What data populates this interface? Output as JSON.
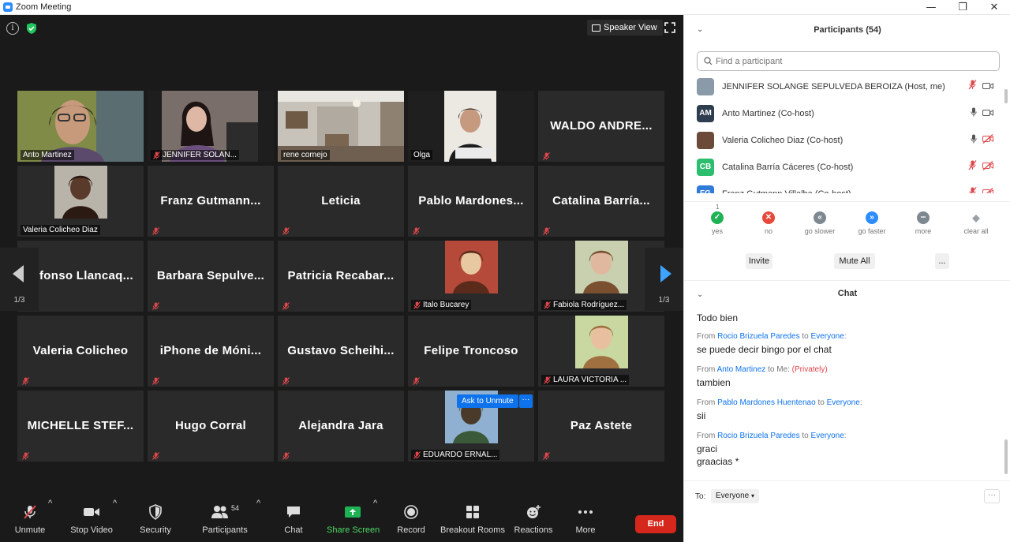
{
  "window": {
    "title": "Zoom Meeting",
    "controls": [
      "—",
      "❐",
      "✕"
    ]
  },
  "meeting": {
    "speaker_view": "Speaker View",
    "page_indicator": "1/3",
    "ask_unmute": "Ask to Unmute",
    "ask_more": "···",
    "tiles": [
      {
        "name": "Anto Martinez",
        "style": "video",
        "muted": false
      },
      {
        "name": "JENNIFER SOLAN...",
        "style": "video",
        "muted": true
      },
      {
        "name": "rene cornejo",
        "style": "video",
        "muted": false
      },
      {
        "name": "Olga",
        "style": "video",
        "muted": false
      },
      {
        "name": "WALDO  ANDRE...",
        "style": "name",
        "muted": true
      },
      {
        "name": "Valeria Colicheo Diaz",
        "style": "photo",
        "muted": false
      },
      {
        "name": "Franz  Gutmann...",
        "style": "name",
        "muted": true
      },
      {
        "name": "Leticia",
        "style": "name",
        "muted": true
      },
      {
        "name": "Pablo  Mardones...",
        "style": "name",
        "muted": true
      },
      {
        "name": "Catalina  Barría...",
        "style": "name",
        "muted": true
      },
      {
        "name": "fonso  Llancaq...",
        "style": "name",
        "muted": true
      },
      {
        "name": "Barbara  Sepulve...",
        "style": "name",
        "muted": true
      },
      {
        "name": "Patricia  Recabar...",
        "style": "name",
        "muted": true
      },
      {
        "name": "Italo Bucarey",
        "style": "photo",
        "muted": true
      },
      {
        "name": "Fabiola Rodríguez...",
        "style": "photo",
        "muted": true
      },
      {
        "name": "Valeria Colicheo",
        "style": "name",
        "muted": true
      },
      {
        "name": "iPhone de Móni...",
        "style": "name",
        "muted": true
      },
      {
        "name": "Gustavo  Scheihi...",
        "style": "name",
        "muted": true
      },
      {
        "name": "Felipe Troncoso",
        "style": "name",
        "muted": true
      },
      {
        "name": "LAURA VICTORIA ...",
        "style": "photo",
        "muted": true
      },
      {
        "name": "MICHELLE  STEF...",
        "style": "name",
        "muted": true
      },
      {
        "name": "Hugo Corral",
        "style": "name",
        "muted": true
      },
      {
        "name": "Alejandra Jara",
        "style": "name",
        "muted": true
      },
      {
        "name": "EDUARDO ERNAL...",
        "style": "photo",
        "muted": true
      },
      {
        "name": "Paz Astete",
        "style": "name",
        "muted": true
      }
    ]
  },
  "toolbar": {
    "unmute": "Unmute",
    "stop_video": "Stop Video",
    "security": "Security",
    "participants": "Participants",
    "participants_count": "54",
    "chat": "Chat",
    "share_screen": "Share Screen",
    "record": "Record",
    "breakout_rooms": "Breakout Rooms",
    "reactions": "Reactions",
    "more": "More",
    "end": "End"
  },
  "participants_panel": {
    "title": "Participants (54)",
    "search_placeholder": "Find a participant",
    "rows": [
      {
        "initials": "",
        "name": "JENNIFER SOLANGE SEPULVEDA BEROIZA (Host, me)",
        "avatar_color": "#8a9aa8",
        "mic_muted": true,
        "video_off": false
      },
      {
        "initials": "AM",
        "name": "Anto Martinez (Co-host)",
        "avatar_color": "#2e3d4f",
        "mic_muted": false,
        "video_off": false
      },
      {
        "initials": "",
        "name": "Valeria Colicheo Diaz (Co-host)",
        "avatar_color": "#6b4a3a",
        "mic_muted": false,
        "video_off": true
      },
      {
        "initials": "CB",
        "name": "Catalina Barría Cáceres (Co-host)",
        "avatar_color": "#2dbd6e",
        "mic_muted": true,
        "video_off": true
      },
      {
        "initials": "FG",
        "name": "Franz Gutmann Villalba (Co-host)",
        "avatar_color": "#2f7bd8",
        "mic_muted": true,
        "video_off": true
      }
    ],
    "reaction_count": "1",
    "reactions": [
      {
        "label": "yes",
        "symbol": "✓",
        "color": "#1fb255"
      },
      {
        "label": "no",
        "symbol": "✕",
        "color": "#e6493a"
      },
      {
        "label": "go slower",
        "symbol": "«",
        "color": "#7e8891"
      },
      {
        "label": "go faster",
        "symbol": "»",
        "color": "#2d8cff"
      },
      {
        "label": "more",
        "symbol": "•••",
        "color": "#7e8891"
      },
      {
        "label": "clear all",
        "symbol": "◆",
        "color": "#9aa0a6"
      }
    ],
    "invite": "Invite",
    "mute_all": "Mute All",
    "more": "..."
  },
  "chat_panel": {
    "title": "Chat",
    "messages": [
      {
        "from": "",
        "to": "",
        "private": "",
        "lines": [
          "Todo bien"
        ]
      },
      {
        "from": "Rocio Brizuela Paredes",
        "to": "Everyone",
        "private": "",
        "lines": [
          "se puede decir bingo por el chat"
        ]
      },
      {
        "from": "Anto Martinez",
        "to": "Me",
        "private": "(Privately)",
        "lines": [
          "tambien"
        ]
      },
      {
        "from": "Pablo Mardones Huentenao",
        "to": "Everyone",
        "private": "",
        "lines": [
          "sii"
        ]
      },
      {
        "from": "Rocio Brizuela Paredes",
        "to": "Everyone",
        "private": "",
        "lines": [
          "graci",
          "graacias *"
        ]
      }
    ],
    "from_label": "From",
    "to_word": "to",
    "to_label": "To:",
    "recipient": "Everyone",
    "more": "···"
  },
  "colors": {
    "accent": "#0e72ed",
    "active_speaker": "#d9e86a",
    "end": "#d6271c",
    "muted": "#e0474c"
  }
}
